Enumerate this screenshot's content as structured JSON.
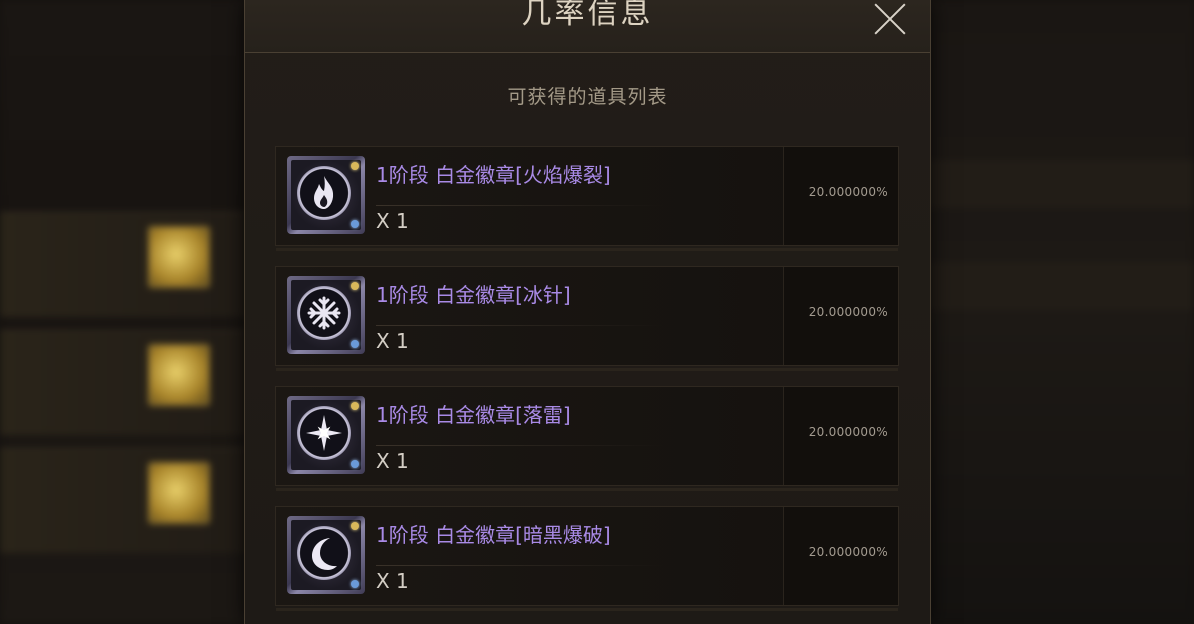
{
  "modal": {
    "title": "几率信息",
    "subtitle": "可获得的道具列表",
    "close_icon": "close-icon"
  },
  "items": [
    {
      "name": "1阶段 白金徽章[火焰爆裂]",
      "quantity": "X 1",
      "probability": "20.000000%",
      "icon": "fire-icon"
    },
    {
      "name": "1阶段 白金徽章[冰针]",
      "quantity": "X 1",
      "probability": "20.000000%",
      "icon": "snowflake-icon"
    },
    {
      "name": "1阶段 白金徽章[落雷]",
      "quantity": "X 1",
      "probability": "20.000000%",
      "icon": "star-burst-icon"
    },
    {
      "name": "1阶段 白金徽章[暗黑爆破]",
      "quantity": "X 1",
      "probability": "20.000000%",
      "icon": "crescent-moon-icon"
    }
  ],
  "colors": {
    "item_name": "#a98ae6",
    "title": "#ddd3c1",
    "subtitle": "#a49a88",
    "background": "#1e1a16"
  }
}
